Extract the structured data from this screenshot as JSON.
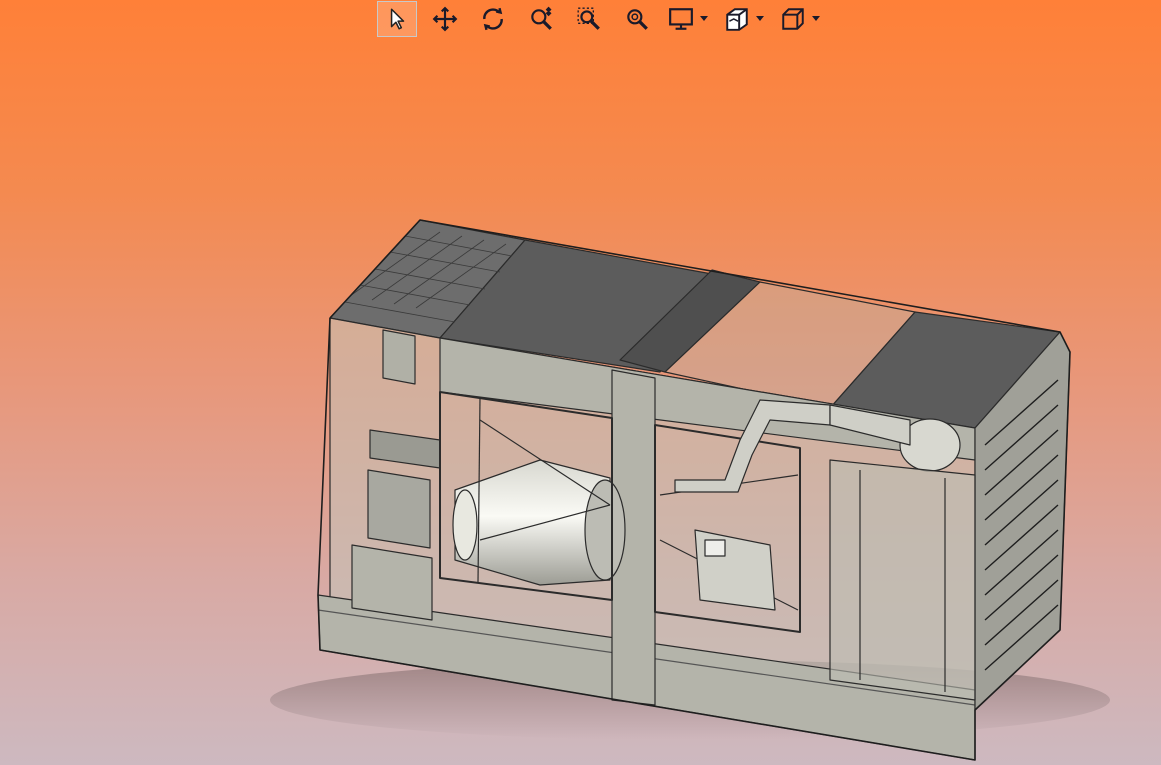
{
  "viewer": {
    "background_top": "#ff8038",
    "background_bottom": "#cdb9c0",
    "toolbar": {
      "tools": [
        {
          "id": "select",
          "icon": "select-arrow-icon",
          "active": true
        },
        {
          "id": "pan",
          "icon": "pan-move-icon",
          "active": false
        },
        {
          "id": "rotate",
          "icon": "rotate-icon",
          "active": false
        },
        {
          "id": "zoom",
          "icon": "zoom-icon",
          "active": false
        },
        {
          "id": "zoom-window",
          "icon": "zoom-window-icon",
          "active": false
        },
        {
          "id": "zoom-fit",
          "icon": "zoom-fit-icon",
          "active": false
        }
      ],
      "dropdowns": [
        {
          "id": "display",
          "icon": "monitor-icon"
        },
        {
          "id": "section",
          "icon": "section-plane-icon"
        },
        {
          "id": "view",
          "icon": "cube-view-icon"
        }
      ]
    },
    "model": {
      "name_icon": "generator-enclosure-model",
      "body_color": "#b4b4aa",
      "roof_color": "#5a5a5a",
      "line_color": "#2b2b2b"
    }
  }
}
